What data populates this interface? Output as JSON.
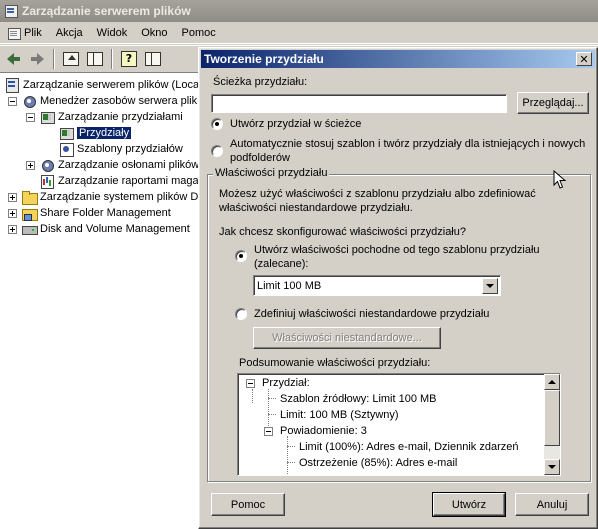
{
  "main_window": {
    "title": "Zarządzanie serwerem plików",
    "menu": [
      "Plik",
      "Akcja",
      "Widok",
      "Okno",
      "Pomoc"
    ]
  },
  "toolbar": {
    "icons": [
      "back-arrow-icon",
      "forward-arrow-icon",
      "up-folder-icon",
      "show-hide-pane-icon",
      "help-icon",
      "properties-icon"
    ]
  },
  "tree": {
    "items": [
      {
        "label": "Zarządzanie serwerem plików (Local",
        "icon": "server-icon"
      },
      {
        "label": "Menedżer zasobów serwera plik",
        "icon": "gear-icon"
      },
      {
        "label": "Zarządzanie przydziałami",
        "icon": "quota-management-icon"
      },
      {
        "label": "Przydziały",
        "icon": "quota-icon"
      },
      {
        "label": "Szablony przydziałów",
        "icon": "template-icon"
      },
      {
        "label": "Zarządzanie osłonami plików",
        "icon": "gear-icon"
      },
      {
        "label": "Zarządzanie raportami maga",
        "icon": "report-icon"
      },
      {
        "label": "Zarządzanie systemem plików DF",
        "icon": "folder-icon"
      },
      {
        "label": "Share Folder Management",
        "icon": "share-icon"
      },
      {
        "label": "Disk and Volume Management",
        "icon": "disk-icon"
      }
    ]
  },
  "dialog": {
    "title": "Tworzenie przydziału",
    "path_label": "Ścieżka przydziału:",
    "path_value": "",
    "browse_button": "Przeglądaj...",
    "radio_create_on_path": "Utwórz przydział w ścieżce",
    "radio_auto_apply_line1": "Automatycznie stosuj szablon i twórz przydziały dla istniejących i nowych",
    "radio_auto_apply_line2": "podfolderów",
    "properties_group": {
      "title": "Właściwości przydziału",
      "description_line1": "Możesz użyć właściwości z szablonu przydziału albo zdefiniować",
      "description_line2": "właściwości niestandardowe przydziału.",
      "question": "Jak chcesz skonfigurować właściwości przydziału?",
      "radio_derive_line1": "Utwórz właściwości pochodne od tego szablonu przydziału",
      "radio_derive_line2": "(zalecane):",
      "template_selected": "Limit 100 MB",
      "radio_custom": "Zdefiniuj właściwości niestandardowe przydziału",
      "custom_button": "Właściwości niestandardowe..."
    },
    "summary": {
      "label": "Podsumowanie właściwości przydziału:",
      "items": [
        "Przydział:",
        "Szablon źródłowy: Limit 100 MB",
        "Limit: 100 MB (Sztywny)",
        "Powiadomienie: 3",
        "Limit (100%): Adres e-mail, Dziennik zdarzeń",
        "Ostrzeżenie (85%): Adres e-mail"
      ]
    },
    "help_button": "Pomoc",
    "create_button": "Utwórz",
    "cancel_button": "Anuluj",
    "close_glyph": "✕"
  }
}
